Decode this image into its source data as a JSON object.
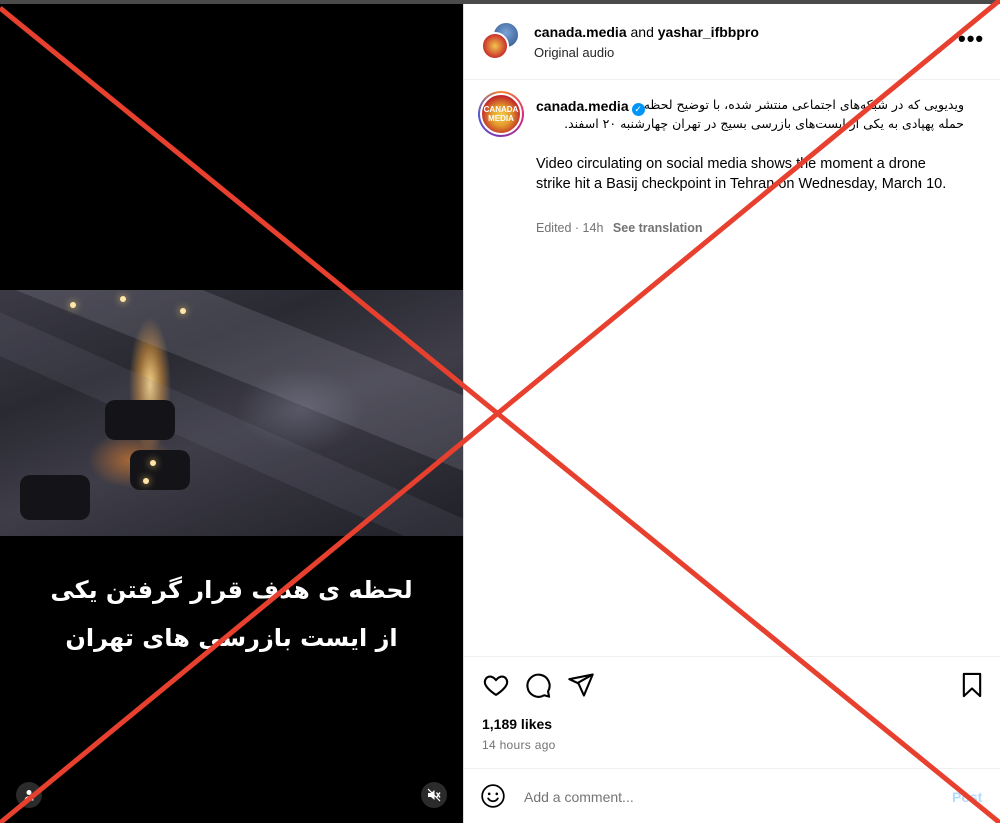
{
  "media": {
    "video_caption_line1": "لحظه ی هدف قرار گرفتن یکی",
    "video_caption_line2": "از ایست بازرسی های تهران",
    "user_tag_icon": "person-icon",
    "mute_icon": "speaker-muted-icon"
  },
  "header": {
    "user1": "canada.media",
    "connector": "and",
    "user2": "yashar_ifbbpro",
    "subtitle": "Original audio",
    "more_icon": "•••"
  },
  "caption": {
    "avatar_text": "CANADA MEDIA",
    "username": "canada.media",
    "verified_icon": "✓",
    "farsi_line1": "ویدیویی که در شبکه‌های اجتماعی منتشر شده، با توضیح لحظه",
    "farsi_line2": "حمله پهپادی به یکی از ایست‌های بازرسی بسیج در تهران چهارشنبه ۲۰ اسفند.",
    "english_text": "Video circulating on social media shows the moment a drone strike hit a Basij checkpoint in Tehran on Wednesday, March 10.",
    "edited": "Edited · 14h",
    "see_translation": "See translation"
  },
  "actions": {
    "like_icon": "heart-icon",
    "comment_icon": "comment-icon",
    "share_icon": "share-icon",
    "save_icon": "bookmark-icon",
    "likes": "1,189 likes",
    "time": "14 hours ago"
  },
  "comment_bar": {
    "emoji_icon": "emoji-icon",
    "placeholder": "Add a comment...",
    "post_label": "Post"
  },
  "colors": {
    "x_overlay": "#e8402f",
    "verified": "#0095f6",
    "post_disabled": "#b3dbff"
  }
}
